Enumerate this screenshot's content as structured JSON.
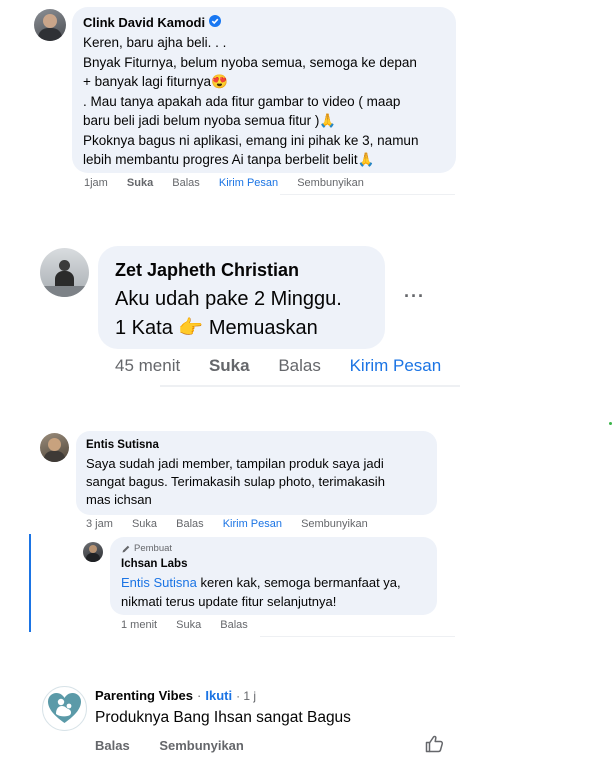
{
  "comment1": {
    "author": "Clink David Kamodi",
    "lines": [
      "Keren, baru ajha beli. . .",
      "Bnyak Fiturnya, belum nyoba semua, semoga ke depan",
      "+ banyak lagi fiturnya😍",
      ". Mau tanya apakah ada fitur gambar to video ( maap",
      "baru beli jadi belum nyoba semua fitur )🙏",
      "Pkoknya bagus ni aplikasi, emang ini pihak ke 3, namun",
      "lebih membantu progres Ai tanpa berbelit belit🙏"
    ],
    "time": "1jam",
    "like": "Suka",
    "reply": "Balas",
    "message": "Kirim Pesan",
    "hide": "Sembunyikan"
  },
  "comment2": {
    "author": "Zet Japheth Christian",
    "line1": "Aku udah pake 2 Minggu.",
    "line2_a": "1 Kata",
    "line2_emoji": "👉",
    "line2_b": "Memuaskan",
    "more": "···",
    "time": "45 menit",
    "like": "Suka",
    "reply": "Balas",
    "message": "Kirim Pesan"
  },
  "comment3": {
    "author": "Entis Sutisna",
    "lines": [
      "Saya sudah jadi member, tampilan produk saya jadi",
      "sangat bagus. Terimakasih sulap photo, terimakasih",
      "mas ichsan"
    ],
    "time": "3 jam",
    "like": "Suka",
    "reply": "Balas",
    "message": "Kirim Pesan",
    "hide": "Sembunyikan"
  },
  "reply3": {
    "badge_icon": "pencil-icon",
    "badge": "Pembuat",
    "author": "Ichsan Labs",
    "mention": "Entis Sutisna",
    "text_after_mention": " keren kak, semoga bermanfaat ya,",
    "line2": "nikmati terus update fitur selanjutnya!",
    "time": "1 menit",
    "like": "Suka",
    "reply": "Balas"
  },
  "comment4": {
    "author": "Parenting Vibes",
    "separator": "·",
    "follow": "Ikuti",
    "time": "· 1 j",
    "text": "Produknya Bang Ihsan sangat Bagus",
    "reply": "Balas",
    "hide": "Sembunyikan",
    "like_icon": "thumbs-up-icon"
  },
  "colors": {
    "bubble": "#eef2f9",
    "link": "#1b74e4",
    "muted": "#65676b",
    "thread_line": "#1b74e4",
    "verified": "#1877f2"
  }
}
